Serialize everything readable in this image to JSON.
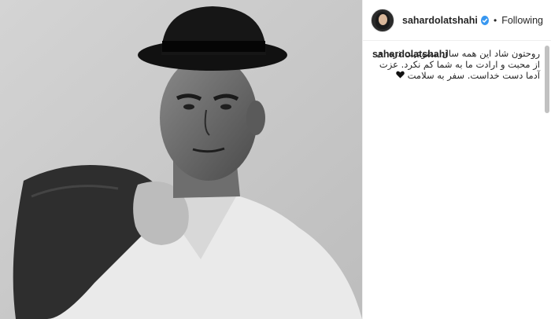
{
  "post": {
    "image_alt": "Black and white portrait of a man in a hat holding a jacket over his shoulder"
  },
  "header": {
    "username": "sahardolatshahi",
    "verified": true,
    "separator": "•",
    "follow_label": "Following"
  },
  "caption": {
    "username": "sahardolatshahi",
    "text": "روحتون شاد این همه سال ممنوعیت ذره ای از محبت و ارادت ما به شما کم نکرد. عزت آدما دست خداست. سفر به سلامت",
    "emoji_icon": "black-heart-icon"
  },
  "colors": {
    "verified_badge": "#3897f0",
    "text": "#262626"
  }
}
